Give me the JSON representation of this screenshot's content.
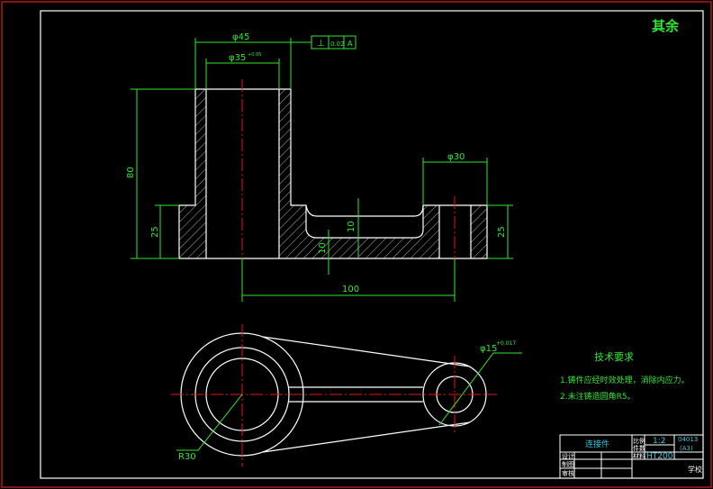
{
  "drawing": {
    "surface_finish": "其余",
    "dimensions": {
      "d45": "φ45",
      "d35": "φ35",
      "d35_tol": "+0.05",
      "flatness_symbol": "⊥",
      "tolerance_value": "0.02",
      "datum": "A",
      "d30": "φ30",
      "h80": "80",
      "h25_left": "25",
      "h25_right": "25",
      "t10_a": "10",
      "t10_b": "10",
      "l100": "100",
      "r30": "R30",
      "d15": "φ15",
      "d15_tol": "+0.017"
    },
    "notes": {
      "title": "技术要求",
      "items": [
        "1.铸件应经时效处理，消除内应力。",
        "2.未注铸造圆角R5。"
      ]
    },
    "title_block": {
      "part_name": "连接件",
      "scale_label": "比例",
      "scale": "1:2",
      "qty_label": "件数",
      "material_label": "材料",
      "material": "HT200",
      "drawing_no": "04013",
      "sheet": "(A3)",
      "designer_label": "设计",
      "drafter_label": "制图",
      "checker_label": "审核",
      "school": "学校"
    }
  }
}
